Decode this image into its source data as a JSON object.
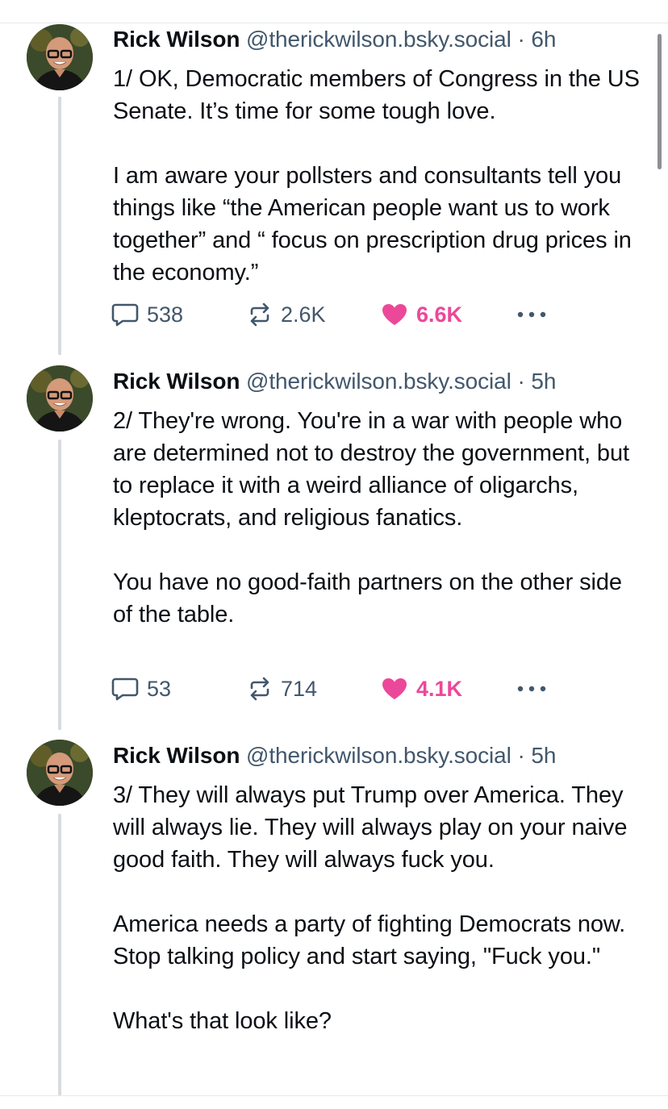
{
  "posts": [
    {
      "author": "Rick Wilson",
      "handle": "@therickwilson.bsky.social",
      "separator": "·",
      "time": "6h",
      "paragraphs": [
        "1/ OK, Democratic members of Congress in the US Senate. It’s time for some tough love.",
        "I am aware your pollsters and consultants tell you things like “the American people want us to work together” and “ focus on prescription drug prices in the economy.”"
      ],
      "replies": "538",
      "reposts": "2.6K",
      "likes": "6.6K"
    },
    {
      "author": "Rick Wilson",
      "handle": "@therickwilson.bsky.social",
      "separator": "·",
      "time": "5h",
      "paragraphs": [
        "2/ They're wrong. You're in a war with people who are determined not to destroy the government, but to replace it with a weird alliance of oligarchs, kleptocrats, and religious fanatics.",
        "You have no good-faith partners on the other side of the table."
      ],
      "replies": "53",
      "reposts": "714",
      "likes": "4.1K"
    },
    {
      "author": "Rick Wilson",
      "handle": "@therickwilson.bsky.social",
      "separator": "·",
      "time": "5h",
      "paragraphs": [
        "3/ They will always put Trump over America. They will always lie. They will always play on your naive good faith. They will always fuck you.",
        "America needs a party of fighting Democrats now. Stop talking policy and start saying, \"Fuck you.\"",
        "What's that look like?"
      ]
    }
  ],
  "icons": {
    "reply": "reply-bubble-icon",
    "repost": "repost-arrows-icon",
    "like": "heart-icon",
    "more": "more-dots-icon"
  },
  "colors": {
    "text": "#0b0f14",
    "secondary": "#42576c",
    "like_active": "#ec4899",
    "thread_line": "#d7dbe0"
  }
}
